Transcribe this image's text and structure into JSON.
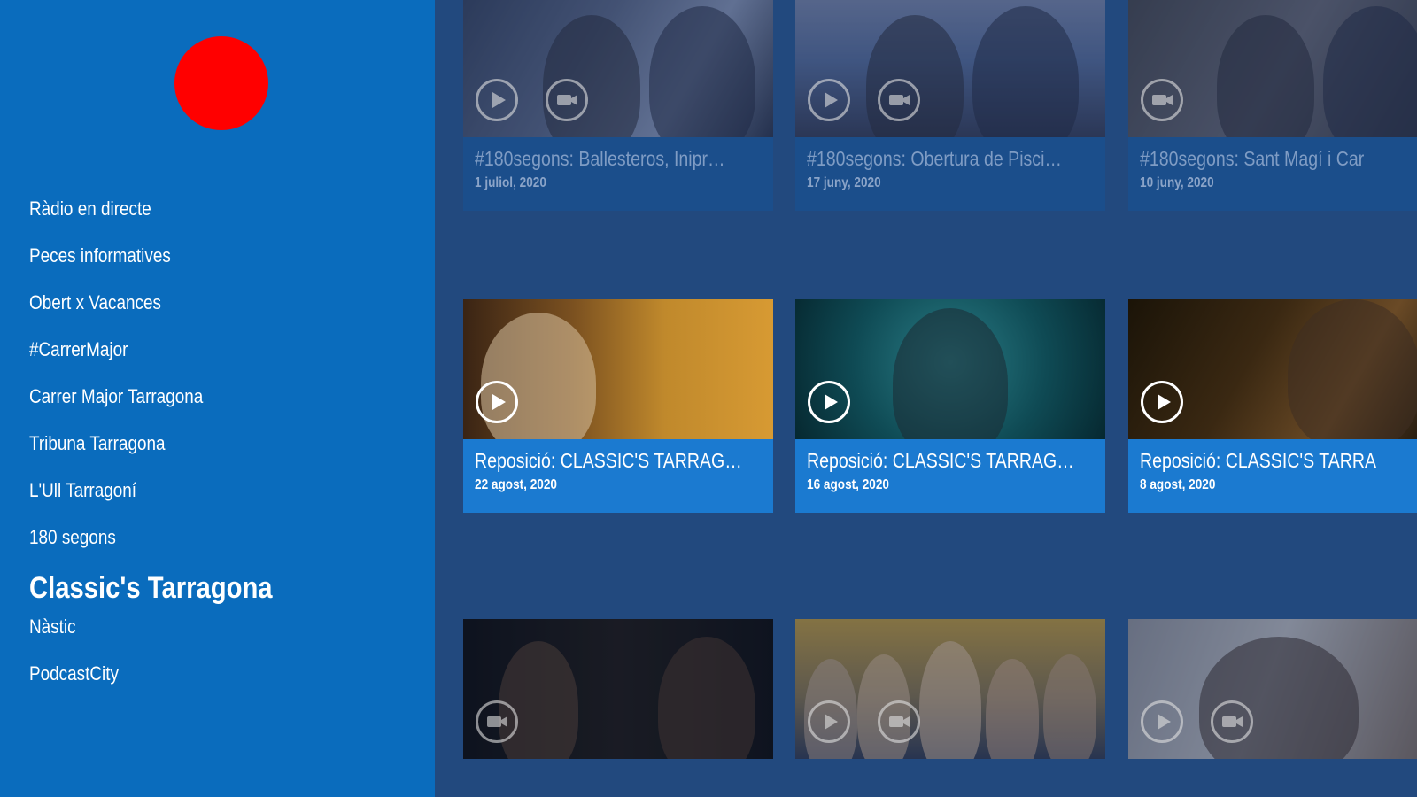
{
  "sidebar": {
    "logo_color": "#ff0000",
    "menu": [
      {
        "label": "Ràdio en directe",
        "active": false
      },
      {
        "label": "Peces informatives",
        "active": false
      },
      {
        "label": "Obert x Vacances",
        "active": false
      },
      {
        "label": "#CarrerMajor",
        "active": false
      },
      {
        "label": "Carrer Major Tarragona",
        "active": false
      },
      {
        "label": "Tribuna Tarragona",
        "active": false
      },
      {
        "label": "L'Ull Tarragoní",
        "active": false
      },
      {
        "label": "180 segons",
        "active": false
      },
      {
        "label": "Classic's Tarragona",
        "active": true
      },
      {
        "label": "Nàstic",
        "active": false
      },
      {
        "label": "PodcastCity",
        "active": false
      }
    ]
  },
  "grid": {
    "rows": [
      {
        "style": "dim",
        "cards": [
          {
            "title": "#180segons: Ballesteros, Inipr…",
            "date": "1 juliol, 2020",
            "icons": [
              "play-icon",
              "video-icon"
            ],
            "thumb": "t-studio"
          },
          {
            "title": "#180segons: Obertura de Pisci…",
            "date": "17 juny, 2020",
            "icons": [
              "play-icon",
              "video-icon"
            ],
            "thumb": "t-pool"
          },
          {
            "title": "#180segons: Sant Magí i Car",
            "date": "10 juny, 2020",
            "icons": [
              "video-icon"
            ],
            "thumb": "t-event"
          }
        ]
      },
      {
        "style": "bright",
        "cards": [
          {
            "title": "Reposició: CLASSIC'S TARRAG…",
            "date": "22 agost, 2020",
            "icons": [
              "play-icon"
            ],
            "thumb": "t-mozart"
          },
          {
            "title": "Reposició: CLASSIC'S TARRAG…",
            "date": "16 agost, 2020",
            "icons": [
              "play-icon"
            ],
            "thumb": "t-zimmer"
          },
          {
            "title": "Reposició: CLASSIC'S TARRA",
            "date": "8 agost, 2020",
            "icons": [
              "play-icon"
            ],
            "thumb": "t-trumpet"
          }
        ]
      },
      {
        "style": "dim",
        "cards": [
          {
            "title": "",
            "date": "",
            "icons": [
              "video-icon"
            ],
            "thumb": "t-interview"
          },
          {
            "title": "",
            "date": "",
            "icons": [
              "play-icon",
              "video-icon"
            ],
            "thumb": "t-group"
          },
          {
            "title": "",
            "date": "",
            "icons": [
              "play-icon",
              "video-icon"
            ],
            "thumb": "t-person"
          }
        ]
      }
    ]
  }
}
